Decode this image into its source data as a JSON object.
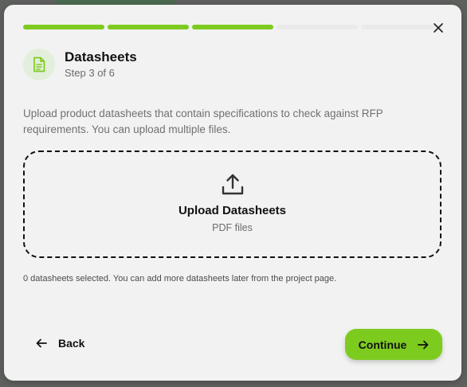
{
  "progress": {
    "total_steps": 6,
    "completed_steps": 3
  },
  "header": {
    "title": "Datasheets",
    "subtitle": "Step 3 of 6",
    "icon": "document-icon"
  },
  "description": "Upload product datasheets that contain specifications to check against RFP requirements. You can upload multiple files.",
  "dropzone": {
    "title": "Upload Datasheets",
    "subtitle": "PDF files",
    "icon": "upload-icon"
  },
  "selection_note": "0 datasheets selected. You can add more datasheets later from the project page.",
  "footer": {
    "back_label": "Back",
    "continue_label": "Continue"
  },
  "colors": {
    "accent": "#7ecb1f",
    "dialog_background": "#f1f2f1",
    "icon_badge": "#e3eedb"
  }
}
